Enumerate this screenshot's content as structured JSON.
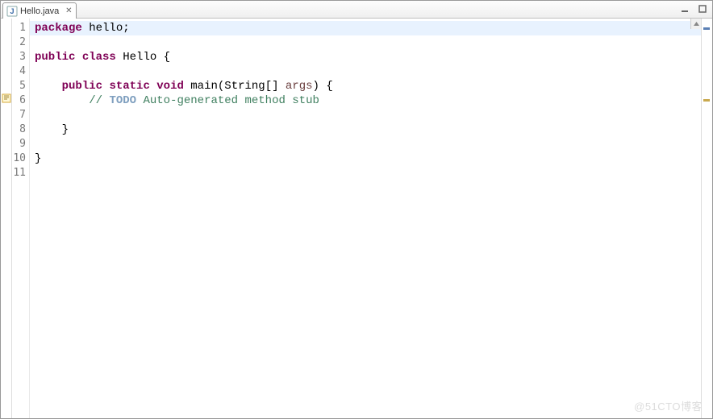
{
  "tab": {
    "filename": "Hello.java"
  },
  "lines": {
    "count": 11,
    "l1": {
      "kw": "package",
      "sp": " ",
      "rest": "hello;"
    },
    "l3": {
      "kw1": "public",
      "sp1": " ",
      "kw2": "class",
      "sp2": " ",
      "rest": "Hello {"
    },
    "l5": {
      "indent": "    ",
      "kw1": "public",
      "sp1": " ",
      "kw2": "static",
      "sp2": " ",
      "kw3": "void",
      "sp3": " ",
      "fn": "main(String[] ",
      "args": "args",
      "rest": ") {"
    },
    "l6": {
      "indent": "        ",
      "slashes": "// ",
      "todo": "TODO",
      "rest": " Auto-generated method stub"
    },
    "l8": {
      "indent": "    ",
      "txt": "}"
    },
    "l10": {
      "txt": "}"
    }
  },
  "gutter": [
    "1",
    "2",
    "3",
    "4",
    "5",
    "6",
    "7",
    "8",
    "9",
    "10",
    "11"
  ],
  "watermark": "@51CTO博客"
}
